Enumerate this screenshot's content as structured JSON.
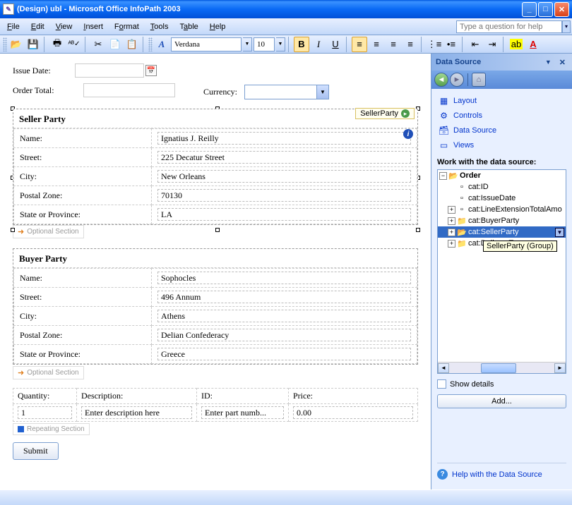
{
  "window": {
    "title": "(Design) ubl - Microsoft Office InfoPath 2003"
  },
  "menu": {
    "file": "File",
    "edit": "Edit",
    "view": "View",
    "insert": "Insert",
    "format": "Format",
    "tools": "Tools",
    "table": "Table",
    "help": "Help",
    "question_placeholder": "Type a question for help"
  },
  "toolbar": {
    "font_name": "Verdana",
    "font_size": "10"
  },
  "form": {
    "issue_date_label": "Issue Date:",
    "order_total_label": "Order Total:",
    "currency_label": "Currency:",
    "seller": {
      "title": "Seller Party",
      "tag": "SellerParty",
      "name_label": "Name:",
      "name_value": "Ignatius J. Reilly",
      "street_label": "Street:",
      "street_value": "225 Decatur Street",
      "city_label": "City:",
      "city_value": "New Orleans",
      "postal_label": "Postal Zone:",
      "postal_value": "70130",
      "state_label": "State or Province:",
      "state_value": "LA"
    },
    "optional_section": "Optional Section",
    "buyer": {
      "title": "Buyer Party",
      "name_label": "Name:",
      "name_value": "Sophocles",
      "street_label": "Street:",
      "street_value": "496 Annum",
      "city_label": "City:",
      "city_value": "Athens",
      "postal_label": "Postal Zone:",
      "postal_value": "Delian Confederacy",
      "state_label": "State or Province:",
      "state_value": "Greece"
    },
    "line": {
      "qty_label": "Quantity:",
      "qty_value": "1",
      "desc_label": "Description:",
      "desc_value": "Enter description here",
      "id_label": "ID:",
      "id_value": "Enter part numb...",
      "price_label": "Price:",
      "price_value": "0.00"
    },
    "repeating_section": "Repeating Section",
    "submit": "Submit"
  },
  "taskpane": {
    "title": "Data Source",
    "layout": "Layout",
    "controls": "Controls",
    "data_source": "Data Source",
    "views": "Views",
    "work_label": "Work with the data source:",
    "tree": {
      "root": "Order",
      "items": [
        "cat:ID",
        "cat:IssueDate",
        "cat:LineExtensionTotalAmo",
        "cat:BuyerParty",
        "cat:SellerParty",
        "cat:DeliveryTerms"
      ],
      "tooltip": "SellerParty (Group)"
    },
    "show_details": "Show details",
    "add": "Add...",
    "help": "Help with the Data Source"
  }
}
